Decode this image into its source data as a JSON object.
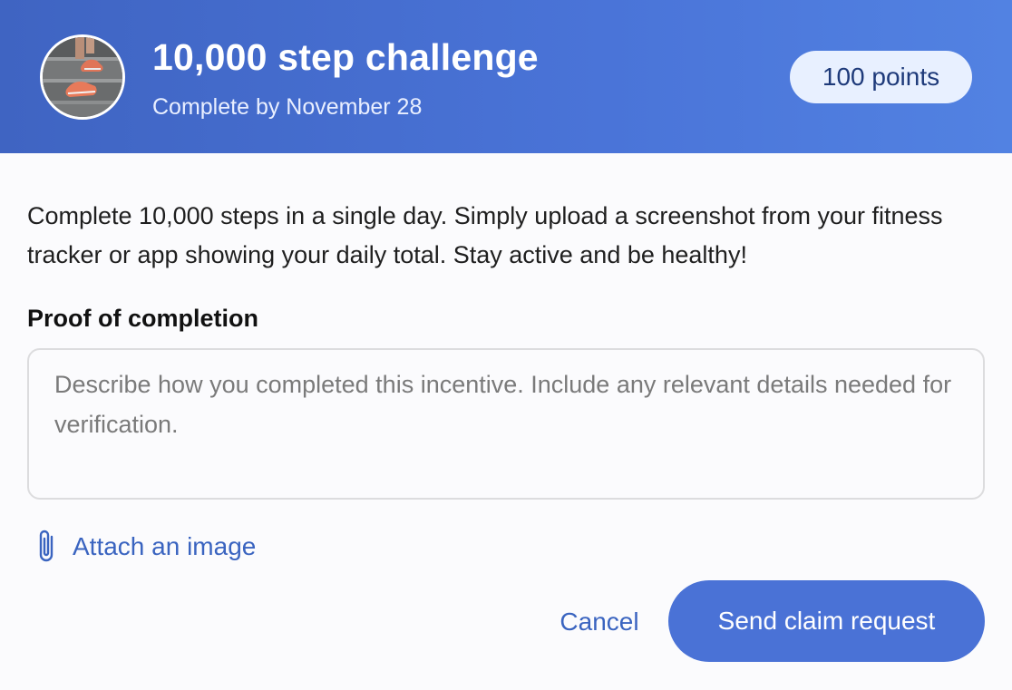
{
  "header": {
    "title": "10,000 step challenge",
    "subtitle": "Complete by November 28",
    "points_badge": "100 points",
    "avatar_icon": "running-shoes-photo"
  },
  "body": {
    "description": "Complete 10,000 steps in a single day. Simply upload a screenshot from your fitness tracker or app showing your daily total. Stay active and be healthy!",
    "proof_label": "Proof of completion",
    "proof_value": "",
    "proof_placeholder": "Describe how you completed this incentive. Include any relevant details needed for verification.",
    "attach_label": "Attach an image",
    "attach_icon": "paperclip-icon"
  },
  "actions": {
    "cancel_label": "Cancel",
    "send_label": "Send claim request"
  },
  "colors": {
    "header_gradient_start": "#3f64c2",
    "header_gradient_end": "#5282e2",
    "accent": "#4a72d6",
    "link": "#3a64c0",
    "badge_bg": "#e8f0ff"
  }
}
